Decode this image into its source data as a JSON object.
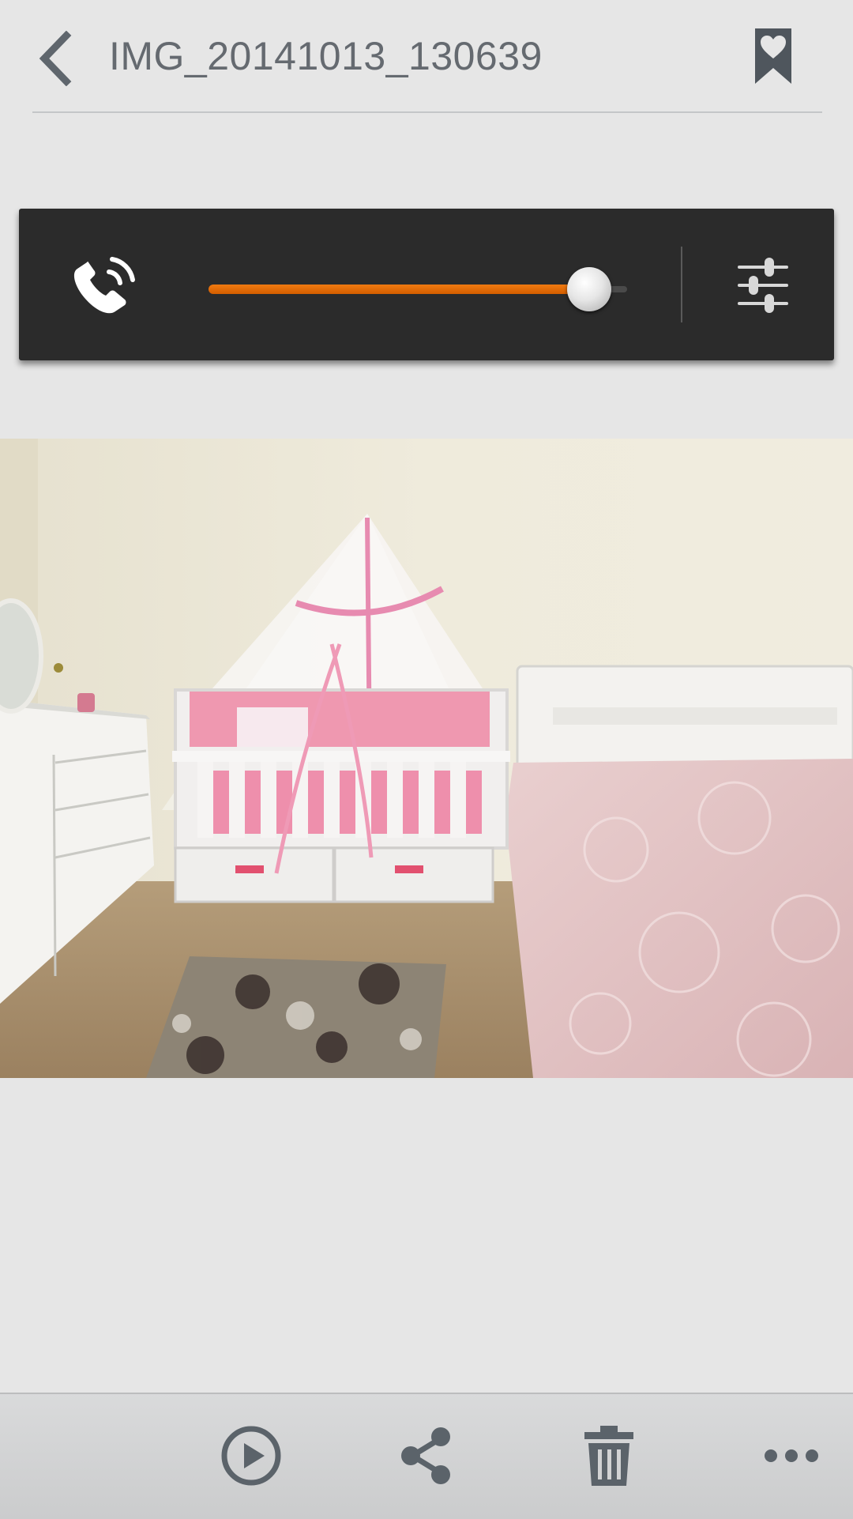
{
  "header": {
    "title": "IMG_20141013_130639",
    "back_icon": "chevron-left-icon",
    "bookmark_icon": "bookmark-heart-icon"
  },
  "volume_panel": {
    "stream_icon": "phone-ring-icon",
    "volume_level": 0.91,
    "settings_icon": "sliders-icon",
    "accent_color": "#e8700a"
  },
  "photo": {
    "content": "bedroom-crib-photo"
  },
  "toolbar": {
    "items": [
      {
        "icon": "play-circle-icon"
      },
      {
        "icon": "share-icon"
      },
      {
        "icon": "trash-icon"
      },
      {
        "icon": "more-icon"
      }
    ]
  }
}
